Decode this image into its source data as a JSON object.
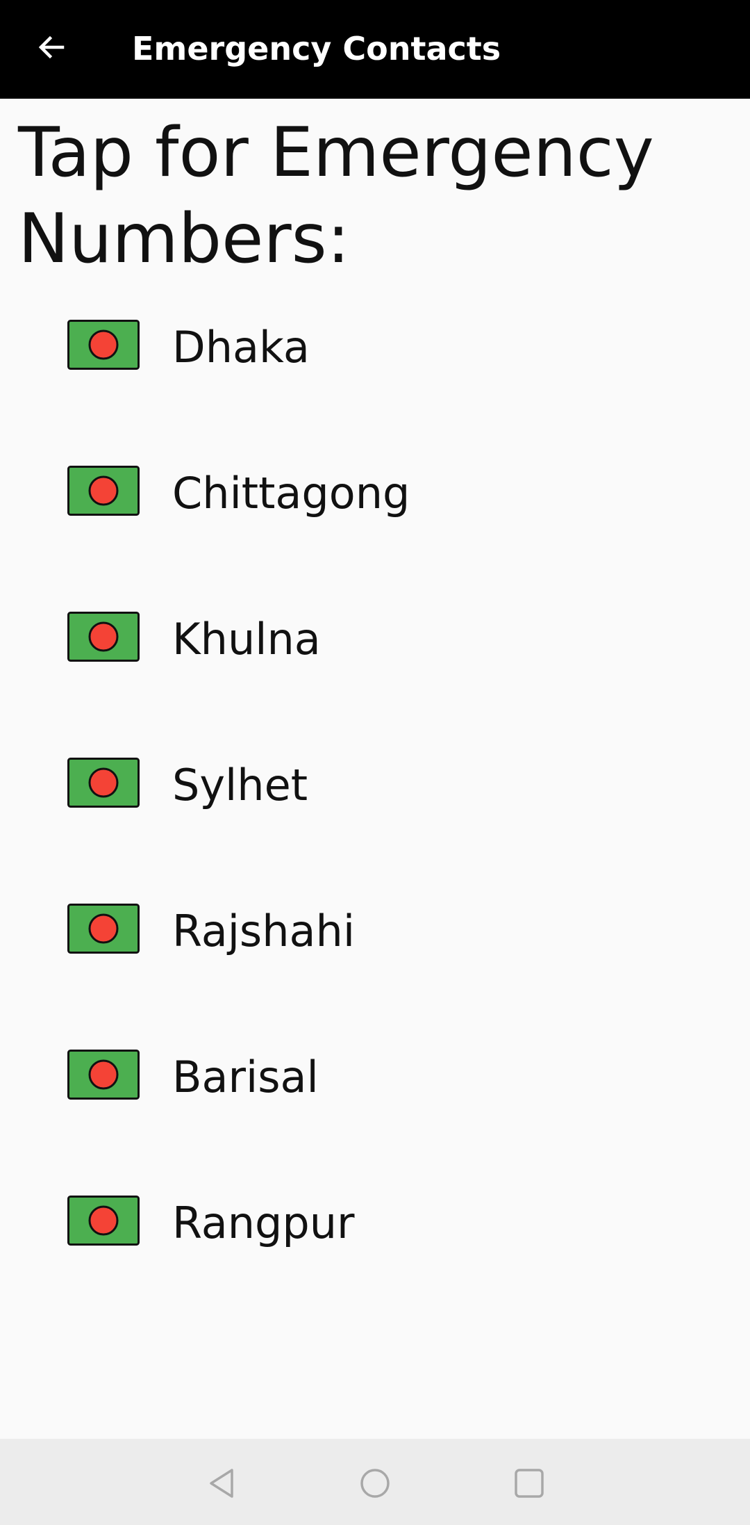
{
  "app_bar": {
    "title": "Emergency Contacts",
    "back_icon": "arrow-left-icon",
    "background": "#000000",
    "title_color": "#ffffff"
  },
  "heading": "Tap for Emergency Numbers:",
  "cities": [
    {
      "label": "Dhaka",
      "icon": "bangladesh-flag-icon"
    },
    {
      "label": "Chittagong",
      "icon": "bangladesh-flag-icon"
    },
    {
      "label": "Khulna",
      "icon": "bangladesh-flag-icon"
    },
    {
      "label": "Sylhet",
      "icon": "bangladesh-flag-icon"
    },
    {
      "label": "Rajshahi",
      "icon": "bangladesh-flag-icon"
    },
    {
      "label": "Barisal",
      "icon": "bangladesh-flag-icon"
    },
    {
      "label": "Rangpur",
      "icon": "bangladesh-flag-icon"
    }
  ],
  "flag_colors": {
    "field": "#4caf50",
    "disc": "#f44336",
    "outline": "#111111"
  },
  "nav_bar": {
    "background": "#ececec",
    "buttons": [
      {
        "icon": "nav-back-triangle-icon"
      },
      {
        "icon": "nav-home-circle-icon"
      },
      {
        "icon": "nav-recents-square-icon"
      }
    ]
  }
}
